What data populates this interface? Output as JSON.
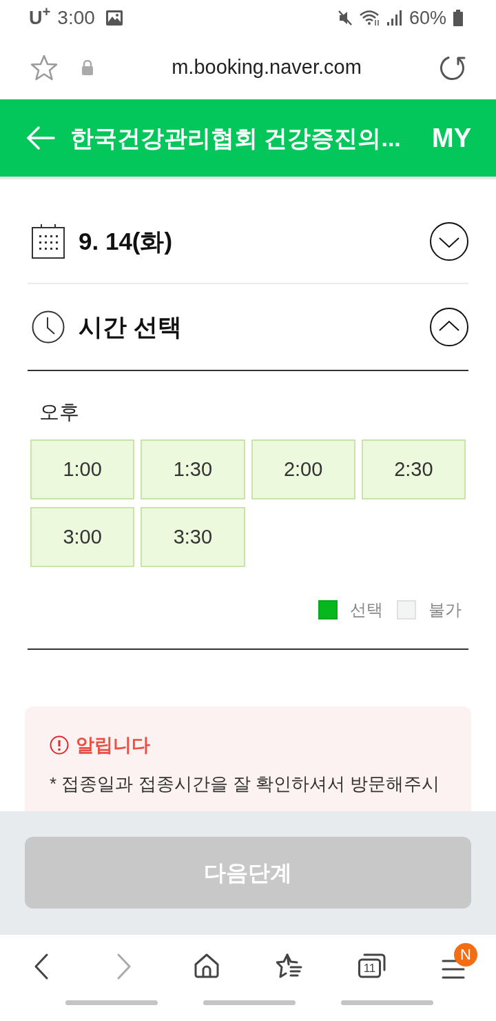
{
  "status_bar": {
    "carrier": "U$^{+}$",
    "time": "3:00",
    "battery": "60%"
  },
  "browser_bar": {
    "url": "m.booking.naver.com"
  },
  "header": {
    "title": "한국건강관리협회 건강증진의...",
    "my": "MY"
  },
  "sections": [
    {
      "kind": "date",
      "label": "9. 14(화)",
      "expanded": false
    },
    {
      "kind": "time",
      "label": "시간 선택",
      "expanded": true
    }
  ],
  "period": "오후",
  "time_slots": [
    {
      "label": "1:00",
      "selected": false
    },
    {
      "label": "1:30",
      "selected": false
    },
    {
      "label": "2:00",
      "selected": false
    },
    {
      "label": "2:30",
      "selected": false
    },
    {
      "label": "3:00",
      "selected": false
    },
    {
      "label": "3:30",
      "selected": false
    }
  ],
  "legend": [
    {
      "label": "선택",
      "color": "#06b81e"
    },
    {
      "label": "불가",
      "color": "#f3f4f4"
    }
  ],
  "notice": {
    "title": "알립니다",
    "text": "* 접종일과 접종시간을 잘 확인하셔서 방문해주시"
  },
  "next_button": {
    "label": "다음단계",
    "disabled": true
  },
  "nav_bar": {
    "tab_count": "11",
    "badge": "N"
  }
}
